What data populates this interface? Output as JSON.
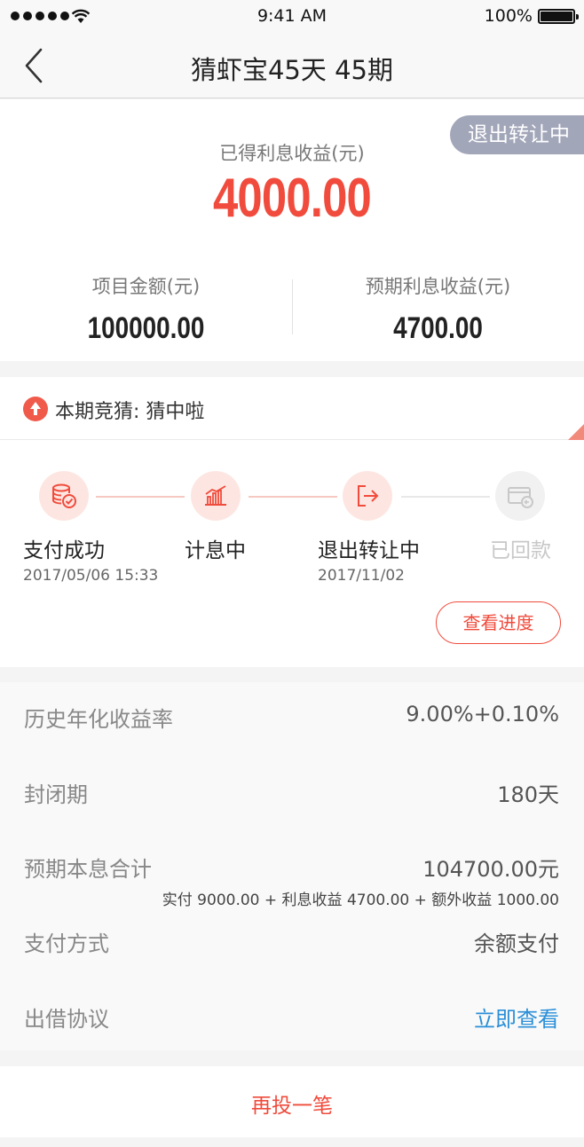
{
  "status_bar": {
    "time": "9:41 AM",
    "battery": "100%"
  },
  "nav": {
    "title": "猜虾宝45天 45期"
  },
  "summary": {
    "status_badge": "退出转让中",
    "earned_label": "已得利息收益(元)",
    "earned_value": "4000.00",
    "project_amount_label": "项目金额(元)",
    "project_amount_value": "100000.00",
    "expected_interest_label": "预期利息收益(元)",
    "expected_interest_value": "4700.00"
  },
  "guess": {
    "text": "本期竞猜: 猜中啦"
  },
  "steps": [
    {
      "label": "支付成功",
      "date": "2017/05/06 15:33",
      "icon": "coins-check-icon",
      "active": true
    },
    {
      "label": "计息中",
      "date": "",
      "icon": "bar-chart-icon",
      "active": true
    },
    {
      "label": "退出转让中",
      "date": "2017/11/02",
      "icon": "exit-arrow-icon",
      "active": true
    },
    {
      "label": "已回款",
      "date": "",
      "icon": "card-return-icon",
      "active": false
    }
  ],
  "progress_button": "查看进度",
  "details": {
    "annual_rate_label": "历史年化收益率",
    "annual_rate_value": "9.00%+0.10%",
    "closed_period_label": "封闭期",
    "closed_period_value": "180天",
    "principal_interest_label": "预期本息合计",
    "principal_interest_value": "104700.00元",
    "principal_interest_breakdown": "实付 9000.00 + 利息收益 4700.00 + 额外收益 1000.00",
    "payment_method_label": "支付方式",
    "payment_method_value": "余额支付",
    "agreement_label": "出借协议",
    "agreement_link": "立即查看"
  },
  "bottom_action": "再投一笔",
  "colors": {
    "accent": "#f04b3c",
    "badge": "#a2a6b9",
    "link": "#2b8fd8"
  }
}
